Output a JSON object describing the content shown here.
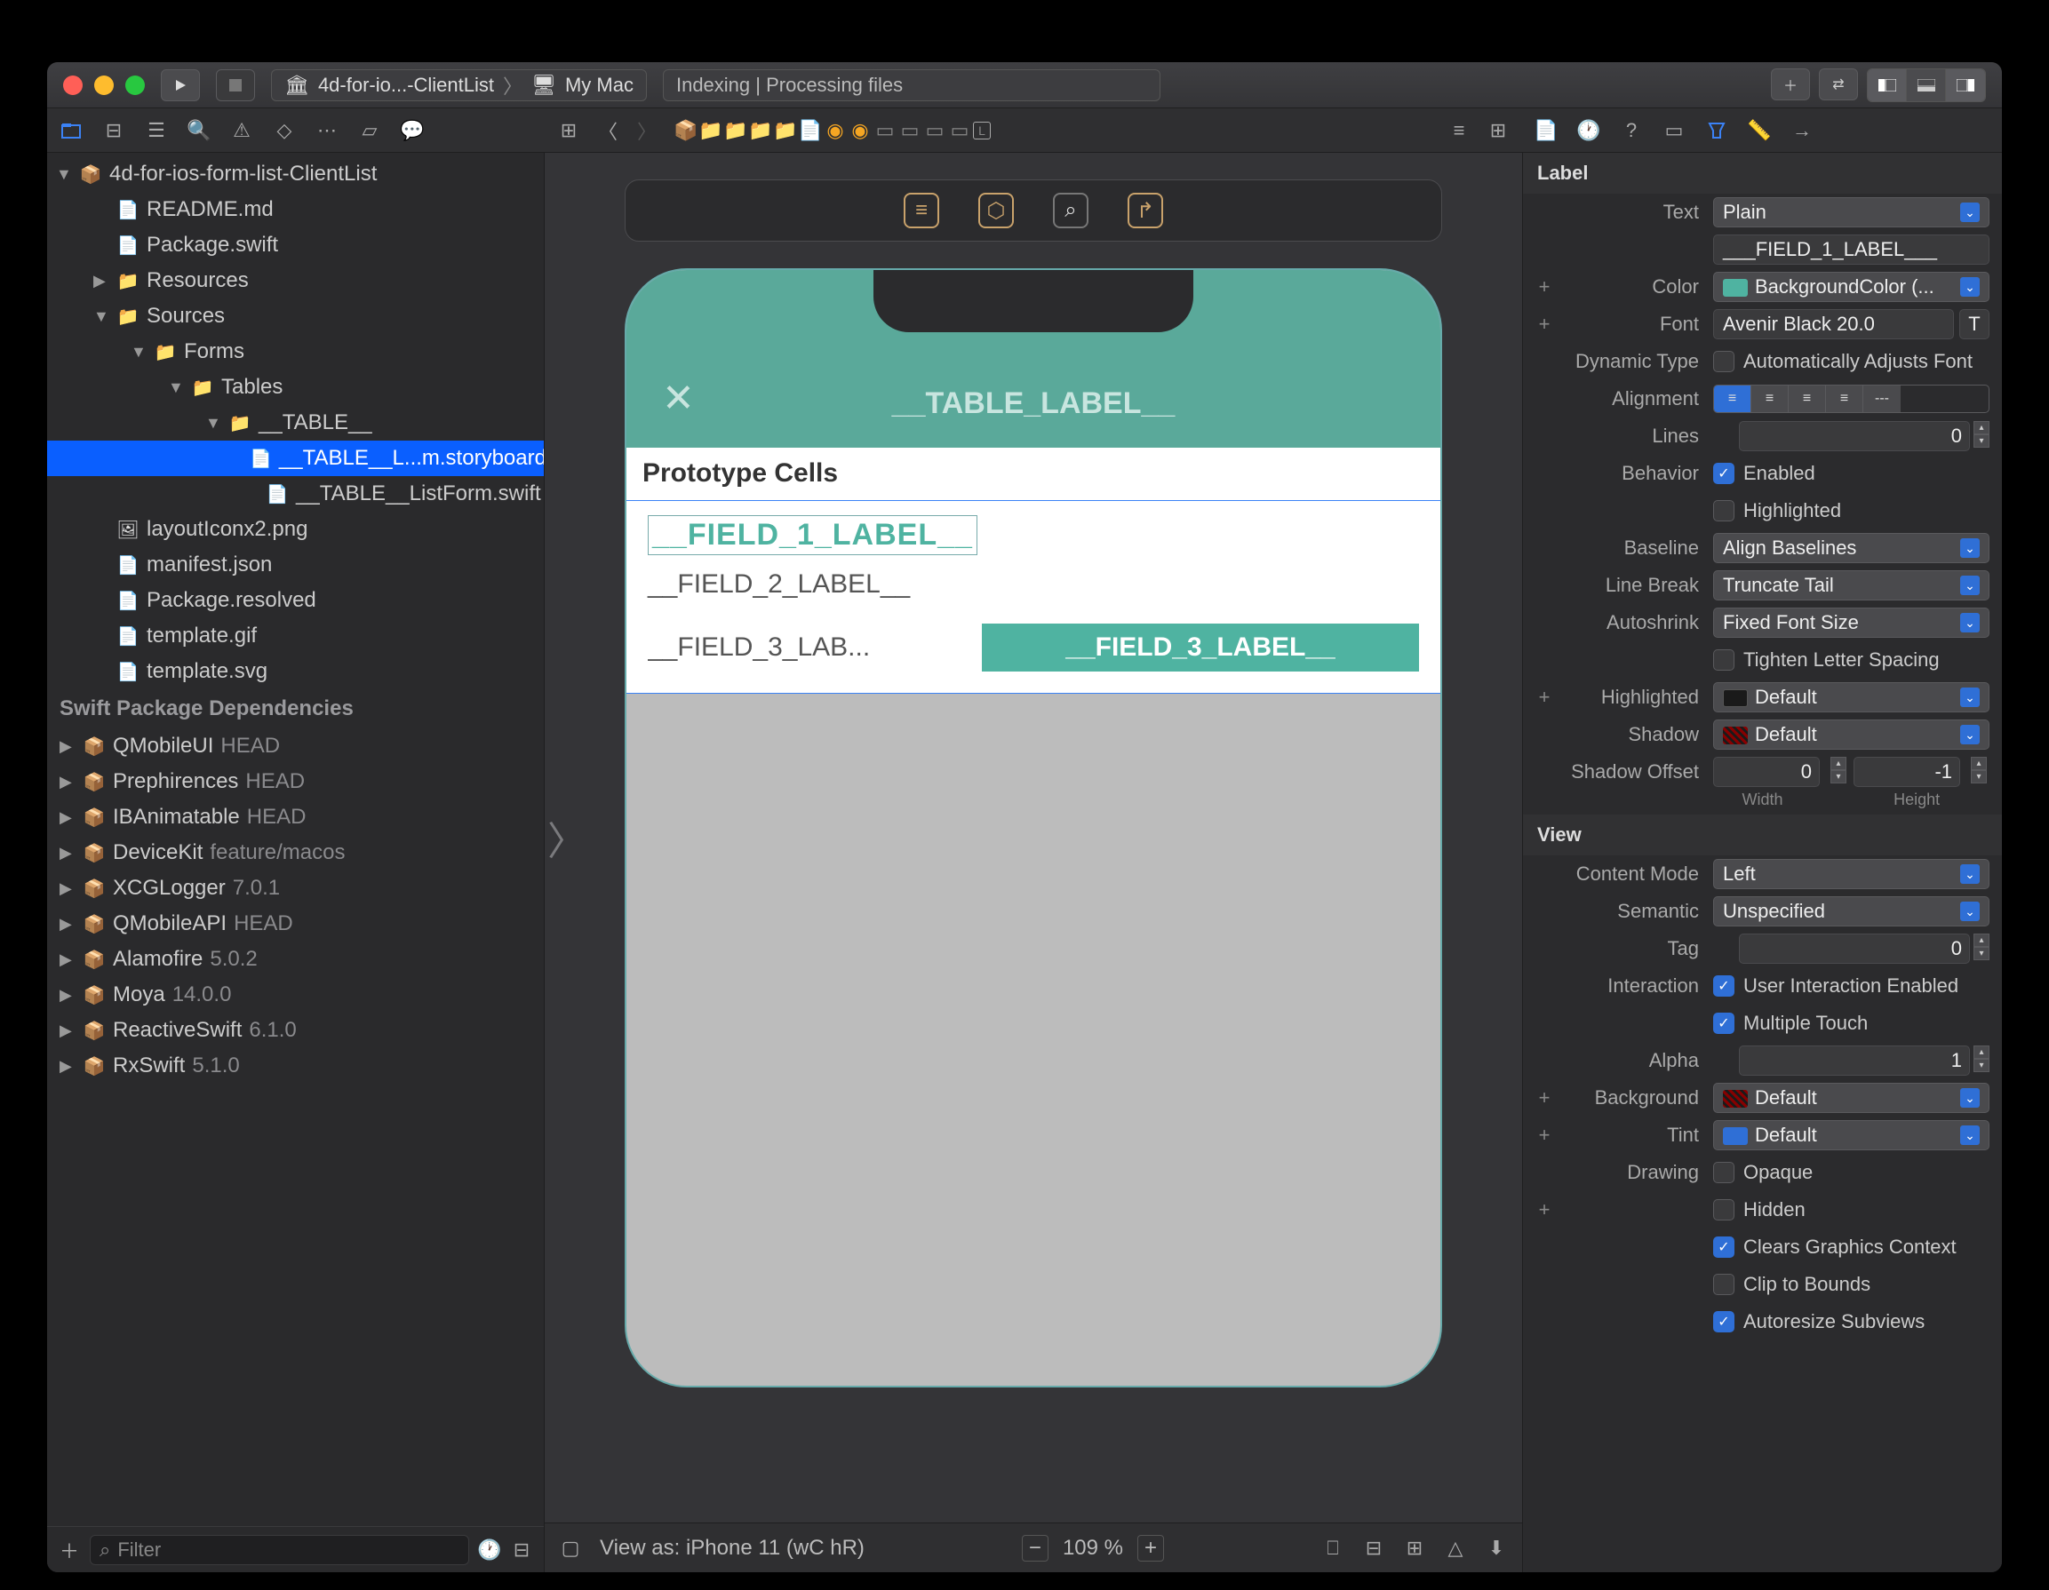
{
  "titlebar": {
    "scheme_project": "4d-for-io...-ClientList",
    "scheme_device": "My Mac",
    "activity": "Indexing | Processing files"
  },
  "navigator": {
    "root": "4d-for-ios-form-list-ClientList",
    "files": {
      "readme": "README.md",
      "package": "Package.swift",
      "resources": "Resources",
      "sources": "Sources",
      "forms": "Forms",
      "tables": "Tables",
      "table_folder": "__TABLE__",
      "storyboard": "__TABLE__L...m.storyboard",
      "listform": "__TABLE__ListForm.swift",
      "layouticon": "layoutIconx2.png",
      "manifest": "manifest.json",
      "package_resolved": "Package.resolved",
      "template_gif": "template.gif",
      "template_svg": "template.svg"
    },
    "deps_header": "Swift Package Dependencies",
    "deps": [
      {
        "name": "QMobileUI",
        "ver": "HEAD"
      },
      {
        "name": "Prephirences",
        "ver": "HEAD"
      },
      {
        "name": "IBAnimatable",
        "ver": "HEAD"
      },
      {
        "name": "DeviceKit",
        "ver": "feature/macos"
      },
      {
        "name": "XCGLogger",
        "ver": "7.0.1"
      },
      {
        "name": "QMobileAPI",
        "ver": "HEAD"
      },
      {
        "name": "Alamofire",
        "ver": "5.0.2"
      },
      {
        "name": "Moya",
        "ver": "14.0.0"
      },
      {
        "name": "ReactiveSwift",
        "ver": "6.1.0"
      },
      {
        "name": "RxSwift",
        "ver": "5.1.0"
      }
    ],
    "filter_placeholder": "Filter"
  },
  "canvas": {
    "header_title": "__TABLE_LABEL__",
    "prototype": "Prototype Cells",
    "f1": "__FIELD_1_LABEL__",
    "f2": "__FIELD_2_LABEL__",
    "f3a": "__FIELD_3_LAB...",
    "f3b": "__FIELD_3_LABEL__",
    "view_as": "View as: iPhone 11 (wC hR)",
    "zoom": "109 %"
  },
  "inspector": {
    "label_header": "Label",
    "text_mode": "Plain",
    "text_value": "___FIELD_1_LABEL___",
    "color": "BackgroundColor (...",
    "color_chip": "#4fb3a1",
    "font": "Avenir Black 20.0",
    "dyn_type_label": "Dynamic Type",
    "dyn_type": "Automatically Adjusts Font",
    "alignment_label": "Alignment",
    "lines_label": "Lines",
    "lines": "0",
    "behavior_label": "Behavior",
    "behavior_enabled": "Enabled",
    "behavior_highlighted": "Highlighted",
    "baseline_label": "Baseline",
    "baseline": "Align Baselines",
    "linebreak_label": "Line Break",
    "linebreak": "Truncate Tail",
    "autoshrink_label": "Autoshrink",
    "autoshrink": "Fixed Font Size",
    "tighten": "Tighten Letter Spacing",
    "highlighted_label": "Highlighted",
    "highlighted": "Default",
    "shadow_label": "Shadow",
    "shadow": "Default",
    "shadow_offset_label": "Shadow Offset",
    "shadow_w": "0",
    "shadow_h": "-1",
    "width_lbl": "Width",
    "height_lbl": "Height",
    "view_header": "View",
    "content_mode_label": "Content Mode",
    "content_mode": "Left",
    "semantic_label": "Semantic",
    "semantic": "Unspecified",
    "tag_label": "Tag",
    "tag": "0",
    "interaction_label": "Interaction",
    "interaction1": "User Interaction Enabled",
    "interaction2": "Multiple Touch",
    "alpha_label": "Alpha",
    "alpha": "1",
    "background_label": "Background",
    "background": "Default",
    "tint_label": "Tint",
    "tint": "Default",
    "tint_chip": "#2f6fd6",
    "drawing_label": "Drawing",
    "drawing_opaque": "Opaque",
    "drawing_hidden": "Hidden",
    "drawing_clears": "Clears Graphics Context",
    "drawing_clip": "Clip to Bounds",
    "drawing_auto": "Autoresize Subviews",
    "text_label": "Text",
    "color_label": "Color",
    "font_label": "Font"
  }
}
